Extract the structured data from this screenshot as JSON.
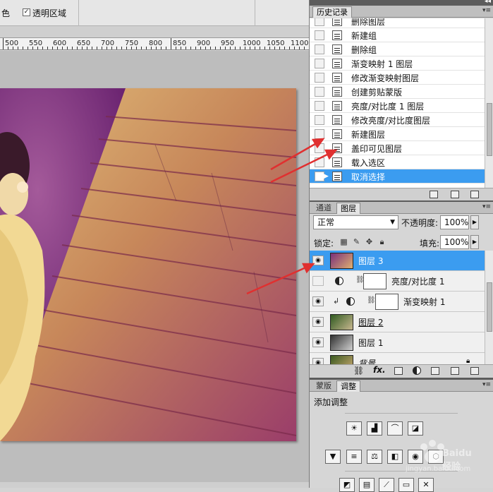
{
  "options_bar": {
    "left_fragment": "色",
    "transparency_checked": true,
    "transparency_label": "透明区域"
  },
  "ruler": {
    "ticks": [
      "500",
      "550",
      "600",
      "650",
      "700",
      "750",
      "800",
      "850",
      "900",
      "950",
      "1000",
      "1050",
      "1100"
    ]
  },
  "history": {
    "tab_label": "历史记录",
    "items": [
      {
        "label": "删除图层",
        "selected": false
      },
      {
        "label": "新建组",
        "selected": false
      },
      {
        "label": "删除组",
        "selected": false
      },
      {
        "label": "渐变映射 1 图层",
        "selected": false
      },
      {
        "label": "修改渐变映射图层",
        "selected": false
      },
      {
        "label": "创建剪贴蒙版",
        "selected": false
      },
      {
        "label": "亮度/对比度 1 图层",
        "selected": false
      },
      {
        "label": "修改亮度/对比度图层",
        "selected": false
      },
      {
        "label": "新建图层",
        "selected": false
      },
      {
        "label": "盖印可见图层",
        "selected": false
      },
      {
        "label": "载入选区",
        "selected": false
      },
      {
        "label": "取消选择",
        "selected": true
      }
    ]
  },
  "layers_panel": {
    "tabs": [
      "通道",
      "图层"
    ],
    "active_tab": "图层",
    "blend_mode": "正常",
    "opacity_label": "不透明度:",
    "opacity_value": "100%",
    "lock_label": "锁定:",
    "fill_label": "填充:",
    "fill_value": "100%",
    "layers": [
      {
        "name": "图层 3",
        "kind": "pixel",
        "selected": true,
        "visible": true
      },
      {
        "name": "亮度/对比度 1",
        "kind": "adjustment",
        "selected": false,
        "visible": false
      },
      {
        "name": "渐变映射 1",
        "kind": "adjustment-clipped",
        "selected": false,
        "visible": true
      },
      {
        "name": "图层 2",
        "kind": "pixel",
        "selected": false,
        "visible": true
      },
      {
        "name": "图层 1",
        "kind": "pixel",
        "selected": false,
        "visible": true
      },
      {
        "name": "背景",
        "kind": "background",
        "selected": false,
        "visible": true
      }
    ]
  },
  "adjustments_panel": {
    "tabs": [
      "蒙版",
      "调整"
    ],
    "active_tab": "调整",
    "title": "添加调整"
  },
  "watermark": {
    "text": "jingyan.baidu.com",
    "brand": "Baidu 经验"
  },
  "colors": {
    "selection": "#3b9cf0",
    "annotation_arrow": "#e03030"
  }
}
